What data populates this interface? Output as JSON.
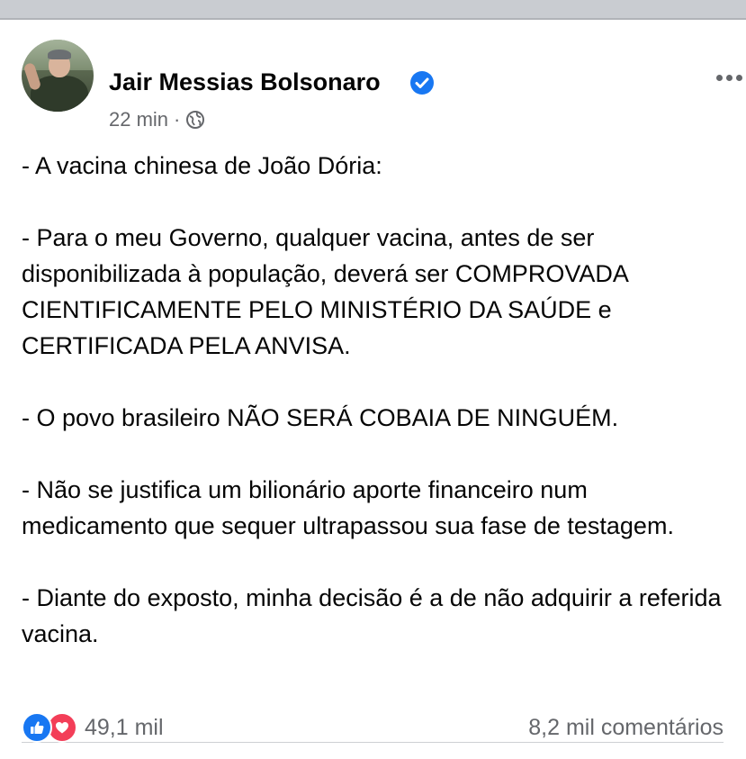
{
  "post": {
    "author": "Jair Messias Bolsonaro",
    "verified": true,
    "time": "22 min",
    "separator": "·",
    "privacy_icon": "globe-icon",
    "paragraphs": [
      "- A vacina chinesa de João Dória:",
      "- Para o meu Governo, qualquer vacina, antes de ser disponibilizada à população, deverá ser COMPROVADA CIENTIFICAMENTE PELO MINISTÉRIO DA SAÚDE e CERTIFICADA PELA ANVISA.",
      "- O povo brasileiro NÃO SERÁ COBAIA DE NINGUÉM.",
      "- Não se justifica um bilionário aporte financeiro num medicamento que sequer ultrapassou sua fase de testagem.",
      "- Diante do exposto, minha decisão é a de não adquirir a referida  vacina."
    ]
  },
  "footer": {
    "reaction_count": "49,1 mil",
    "comments": "8,2 mil comentários",
    "reaction_icons": [
      "like-icon",
      "love-icon"
    ]
  },
  "colors": {
    "accent": "#1877f2",
    "love": "#f33e58",
    "secondary_text": "#65676b",
    "text": "#050505"
  }
}
